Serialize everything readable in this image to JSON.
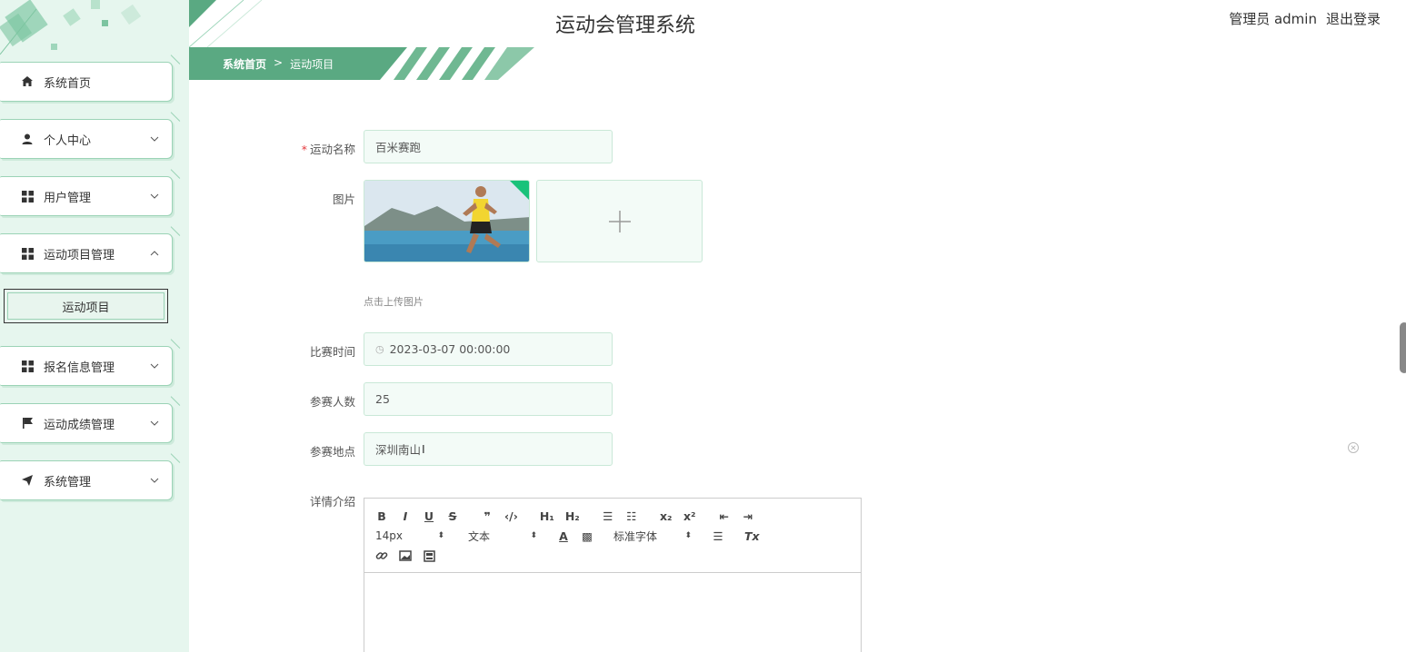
{
  "header": {
    "title": "运动会管理系统",
    "user": "管理员 admin",
    "logout": "退出登录"
  },
  "breadcrumb": {
    "home": "系统首页",
    "sep": ">",
    "current": "运动项目"
  },
  "sidebar": {
    "items": [
      {
        "label": "系统首页",
        "icon": "home-icon"
      },
      {
        "label": "个人中心",
        "icon": "user-icon"
      },
      {
        "label": "用户管理",
        "icon": "grid-icon"
      },
      {
        "label": "运动项目管理",
        "icon": "grid-icon"
      },
      {
        "label": "报名信息管理",
        "icon": "grid-icon"
      },
      {
        "label": "运动成绩管理",
        "icon": "flag-icon"
      },
      {
        "label": "系统管理",
        "icon": "send-icon"
      }
    ],
    "sub_item": "运动项目"
  },
  "form": {
    "name_label": "运动名称",
    "name_value": "百米赛跑",
    "image_label": "图片",
    "upload_tip": "点击上传图片",
    "time_label": "比赛时间",
    "time_value": "2023-03-07 00:00:00",
    "count_label": "参赛人数",
    "count_value": "25",
    "place_label": "参赛地点",
    "place_value": "深圳南山",
    "detail_label": "详情介绍"
  },
  "editor": {
    "font_size": "14px",
    "block_type": "文本",
    "font_family": "标准字体"
  },
  "colors": {
    "accent": "#5aa982",
    "sidebar_bg": "#e6f6ee",
    "field_bg": "#f3fbf7"
  }
}
